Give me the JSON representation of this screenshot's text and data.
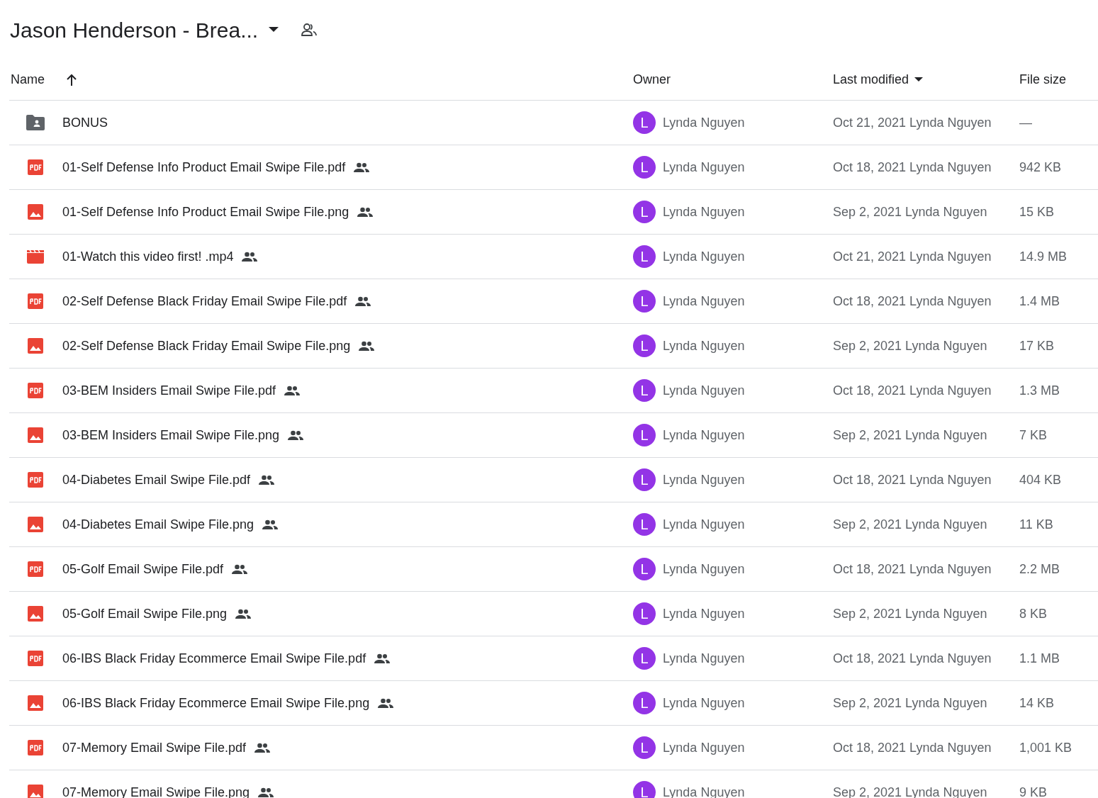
{
  "header": {
    "title": "Jason Henderson - Brea..."
  },
  "table": {
    "columns": [
      {
        "label": "Name",
        "kind": "sort-arrow"
      },
      {
        "label": "Owner",
        "kind": "plain"
      },
      {
        "label": "Last modified",
        "kind": "sort-caret"
      },
      {
        "label": "File size",
        "kind": "plain"
      }
    ],
    "rows": [
      {
        "kind": "folder",
        "name": "BONUS",
        "shared": false,
        "avatar": "L",
        "owner": "Lynda Nguyen",
        "modified": "Oct 21, 2021 Lynda Nguyen",
        "size": "—"
      },
      {
        "kind": "pdf",
        "name": "01-Self Defense Info Product Email Swipe File.pdf",
        "shared": true,
        "avatar": "L",
        "owner": "Lynda Nguyen",
        "modified": "Oct 18, 2021 Lynda Nguyen",
        "size": "942 KB"
      },
      {
        "kind": "image",
        "name": "01-Self Defense Info Product Email Swipe File.png",
        "shared": true,
        "avatar": "L",
        "owner": "Lynda Nguyen",
        "modified": "Sep 2, 2021 Lynda Nguyen",
        "size": "15 KB"
      },
      {
        "kind": "video",
        "name": "01-Watch this video first! .mp4",
        "shared": true,
        "avatar": "L",
        "owner": "Lynda Nguyen",
        "modified": "Oct 21, 2021 Lynda Nguyen",
        "size": "14.9 MB"
      },
      {
        "kind": "pdf",
        "name": "02-Self Defense Black Friday Email Swipe File.pdf",
        "shared": true,
        "avatar": "L",
        "owner": "Lynda Nguyen",
        "modified": "Oct 18, 2021 Lynda Nguyen",
        "size": "1.4 MB"
      },
      {
        "kind": "image",
        "name": "02-Self Defense Black Friday Email Swipe File.png",
        "shared": true,
        "avatar": "L",
        "owner": "Lynda Nguyen",
        "modified": "Sep 2, 2021 Lynda Nguyen",
        "size": "17 KB"
      },
      {
        "kind": "pdf",
        "name": "03-BEM Insiders Email Swipe File.pdf",
        "shared": true,
        "avatar": "L",
        "owner": "Lynda Nguyen",
        "modified": "Oct 18, 2021 Lynda Nguyen",
        "size": "1.3 MB"
      },
      {
        "kind": "image",
        "name": "03-BEM Insiders Email Swipe File.png",
        "shared": true,
        "avatar": "L",
        "owner": "Lynda Nguyen",
        "modified": "Sep 2, 2021 Lynda Nguyen",
        "size": "7 KB"
      },
      {
        "kind": "pdf",
        "name": "04-Diabetes Email Swipe File.pdf",
        "shared": true,
        "avatar": "L",
        "owner": "Lynda Nguyen",
        "modified": "Oct 18, 2021 Lynda Nguyen",
        "size": "404 KB"
      },
      {
        "kind": "image",
        "name": "04-Diabetes Email Swipe File.png",
        "shared": true,
        "avatar": "L",
        "owner": "Lynda Nguyen",
        "modified": "Sep 2, 2021 Lynda Nguyen",
        "size": "11 KB"
      },
      {
        "kind": "pdf",
        "name": "05-Golf Email Swipe File.pdf",
        "shared": true,
        "avatar": "L",
        "owner": "Lynda Nguyen",
        "modified": "Oct 18, 2021 Lynda Nguyen",
        "size": "2.2 MB"
      },
      {
        "kind": "image",
        "name": "05-Golf Email Swipe File.png",
        "shared": true,
        "avatar": "L",
        "owner": "Lynda Nguyen",
        "modified": "Sep 2, 2021 Lynda Nguyen",
        "size": "8 KB"
      },
      {
        "kind": "pdf",
        "name": "06-IBS Black Friday Ecommerce Email Swipe File.pdf",
        "shared": true,
        "avatar": "L",
        "owner": "Lynda Nguyen",
        "modified": "Oct 18, 2021 Lynda Nguyen",
        "size": "1.1 MB"
      },
      {
        "kind": "image",
        "name": "06-IBS Black Friday Ecommerce Email Swipe File.png",
        "shared": true,
        "avatar": "L",
        "owner": "Lynda Nguyen",
        "modified": "Sep 2, 2021 Lynda Nguyen",
        "size": "14 KB"
      },
      {
        "kind": "pdf",
        "name": "07-Memory Email Swipe File.pdf",
        "shared": true,
        "avatar": "L",
        "owner": "Lynda Nguyen",
        "modified": "Oct 18, 2021 Lynda Nguyen",
        "size": "1,001 KB"
      },
      {
        "kind": "image",
        "name": "07-Memory Email Swipe File.png",
        "shared": true,
        "avatar": "L",
        "owner": "Lynda Nguyen",
        "modified": "Sep 2, 2021 Lynda Nguyen",
        "size": "9 KB"
      }
    ]
  }
}
